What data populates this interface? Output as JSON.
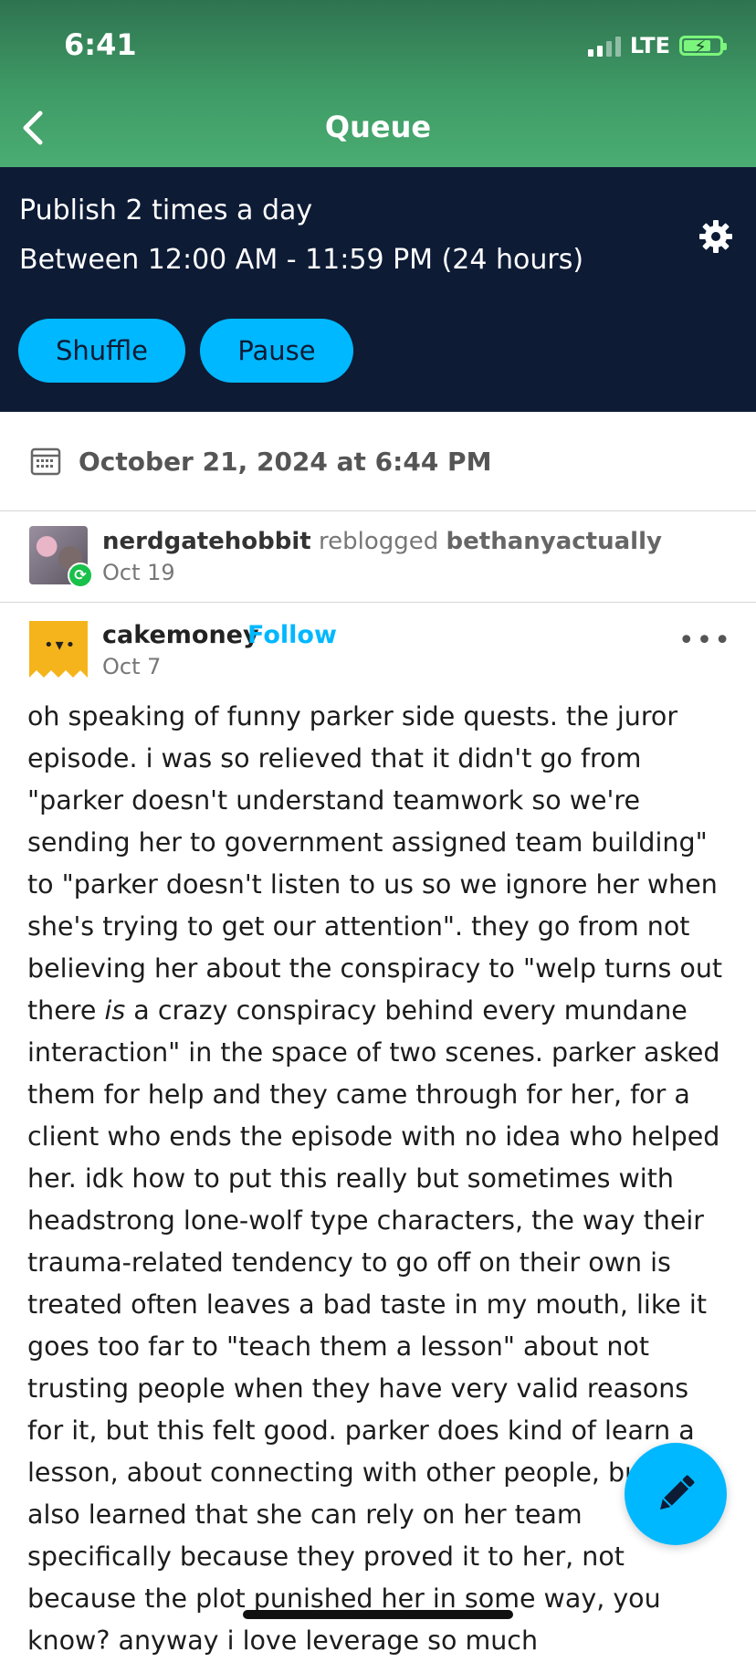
{
  "status_bar": {
    "time": "6:41",
    "network": "LTE"
  },
  "nav": {
    "title": "Queue"
  },
  "schedule": {
    "frequency": "Publish 2 times a day",
    "window": "Between 12:00 AM - 11:59 PM (24 hours)",
    "shuffle_label": "Shuffle",
    "pause_label": "Pause"
  },
  "queue_item": {
    "scheduled_time": "October 21, 2024 at 6:44 PM",
    "reblog": {
      "reblogger": "nerdgatehobbit",
      "action": "reblogged",
      "source": "bethanyactually",
      "date": "Oct 19"
    },
    "post": {
      "author": "cakemoney",
      "follow_label": "Follow",
      "date": "Oct 7",
      "more_label": "•••",
      "body_before_em": "oh speaking of funny parker side quests. the juror episode. i was so relieved that it didn't go from \"parker doesn't understand teamwork so we're sending her to government assigned team building\" to \"parker doesn't listen to us so we ignore her when she's trying to get our attention\". they go from not believing her about the conspiracy to \"welp turns out there ",
      "body_em": "is",
      "body_after_em": " a crazy conspiracy behind every mundane interaction\" in the space of two scenes. parker asked them for help and they came through for her, for a client who ends the episode with no idea who helped her. idk how to put this really but sometimes with headstrong lone-wolf type characters, the way their trauma-related tendency to go off on their own is treated often leaves a bad taste in my mouth, like it goes too far to \"teach them a lesson\" about not trusting people when they have very valid reasons for it, but this felt good. parker does kind of learn a lesson, about connecting with other people, but she also learned that she can rely on her team specifically because they proved it to her, not because the plot punished her in some way, you know? anyway i love leverage so much"
    }
  },
  "colors": {
    "header_green": "#3f9b66",
    "schedule_navy": "#0d1b35",
    "accent_blue": "#00b8ff",
    "reblog_green": "#19c04a"
  },
  "icons": [
    "back-chevron-icon",
    "gear-icon",
    "calendar-icon",
    "reblog-icon",
    "more-options-icon",
    "pencil-icon"
  ]
}
